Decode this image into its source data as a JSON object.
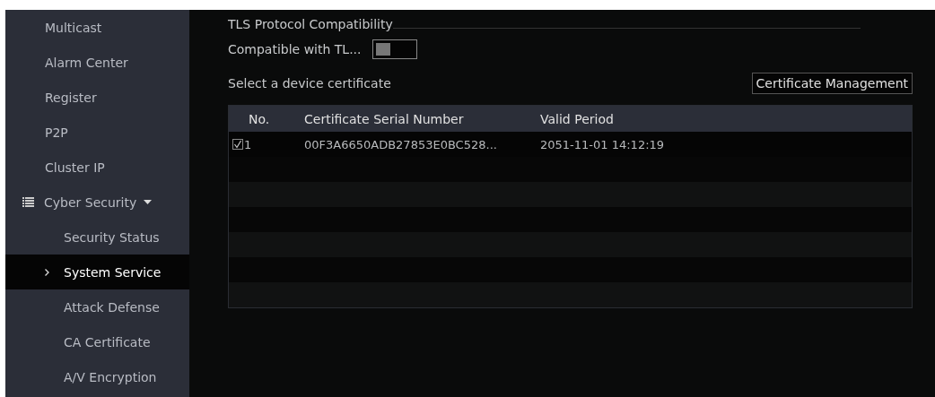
{
  "sidebar": {
    "items": [
      {
        "label": "Multicast",
        "kind": "top",
        "selected": false
      },
      {
        "label": "Alarm Center",
        "kind": "top",
        "selected": false
      },
      {
        "label": "Register",
        "kind": "top",
        "selected": false
      },
      {
        "label": "P2P",
        "kind": "top",
        "selected": false
      },
      {
        "label": "Cluster IP",
        "kind": "top",
        "selected": false
      },
      {
        "label": "Cyber Security",
        "kind": "group",
        "selected": false,
        "expanded": true
      },
      {
        "label": "Security Status",
        "kind": "sub",
        "selected": false
      },
      {
        "label": "System Service",
        "kind": "sub",
        "selected": true
      },
      {
        "label": "Attack Defense",
        "kind": "sub",
        "selected": false
      },
      {
        "label": "CA Certificate",
        "kind": "sub",
        "selected": false
      },
      {
        "label": "A/V Encryption",
        "kind": "sub",
        "selected": false
      }
    ]
  },
  "section": {
    "title": "TLS Protocol Compatibility"
  },
  "compat": {
    "label": "Compatible with TL...",
    "on": false
  },
  "select_label": "Select a device certificate",
  "manage_button": "Certificate Management",
  "table": {
    "columns": [
      "No.",
      "Certificate Serial Number",
      "Valid Period"
    ],
    "rows": [
      {
        "no": "1",
        "checked": true,
        "serial": "00F3A6650ADB27853E0BC528...",
        "period": "2051-11-01 14:12:19"
      }
    ]
  }
}
